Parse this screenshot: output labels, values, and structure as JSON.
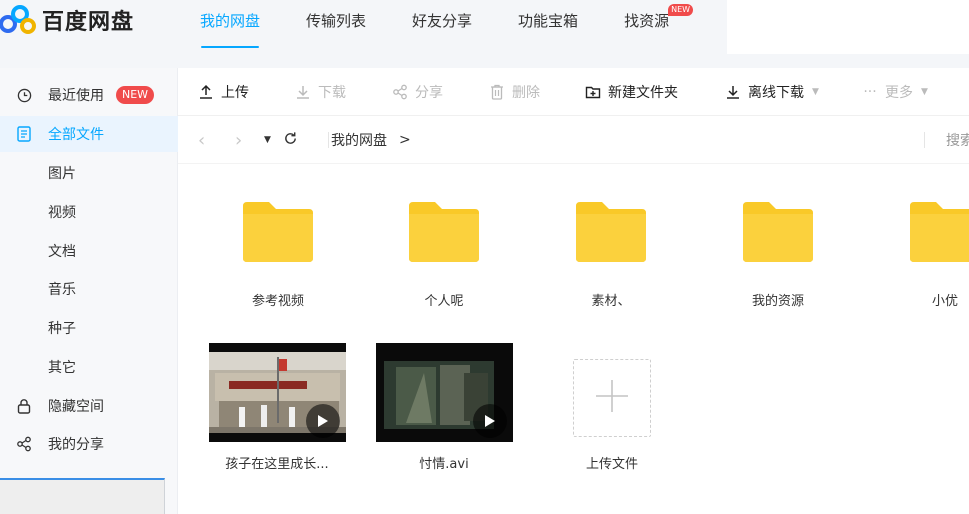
{
  "app": {
    "logo_text": "百度网盘",
    "accent_color": "#06a7ff",
    "badge_color": "#f04b4b",
    "folder_color": "#f9c928"
  },
  "topnav": {
    "items": [
      {
        "label": "我的网盘",
        "active": true
      },
      {
        "label": "传输列表"
      },
      {
        "label": "好友分享"
      },
      {
        "label": "功能宝箱"
      },
      {
        "label": "找资源",
        "badge": "NEW"
      }
    ]
  },
  "sidebar": {
    "items": [
      {
        "label": "最近使用",
        "icon": "clock-icon",
        "badge": "NEW"
      },
      {
        "label": "全部文件",
        "icon": "document-icon",
        "active": true
      },
      {
        "label": "图片"
      },
      {
        "label": "视频"
      },
      {
        "label": "文档"
      },
      {
        "label": "音乐"
      },
      {
        "label": "种子"
      },
      {
        "label": "其它"
      },
      {
        "label": "隐藏空间",
        "icon": "lock-icon"
      },
      {
        "label": "我的分享",
        "icon": "share-icon"
      }
    ]
  },
  "toolbar": {
    "upload": "上传",
    "download": "下载",
    "share": "分享",
    "delete": "删除",
    "new_folder": "新建文件夹",
    "offline_download": "离线下载",
    "more": "更多"
  },
  "path": {
    "root": "我的网盘",
    "separator": ">",
    "search_hint": "搜索"
  },
  "folders": [
    {
      "name": "参考视频"
    },
    {
      "name": "个人呢"
    },
    {
      "name": "素材、"
    },
    {
      "name": "我的资源"
    },
    {
      "name": "小优"
    }
  ],
  "files": [
    {
      "name": "孩子在这里成长...",
      "type": "video"
    },
    {
      "name": "忖情.avi",
      "type": "video"
    }
  ],
  "upload_tile": {
    "label": "上传文件"
  }
}
